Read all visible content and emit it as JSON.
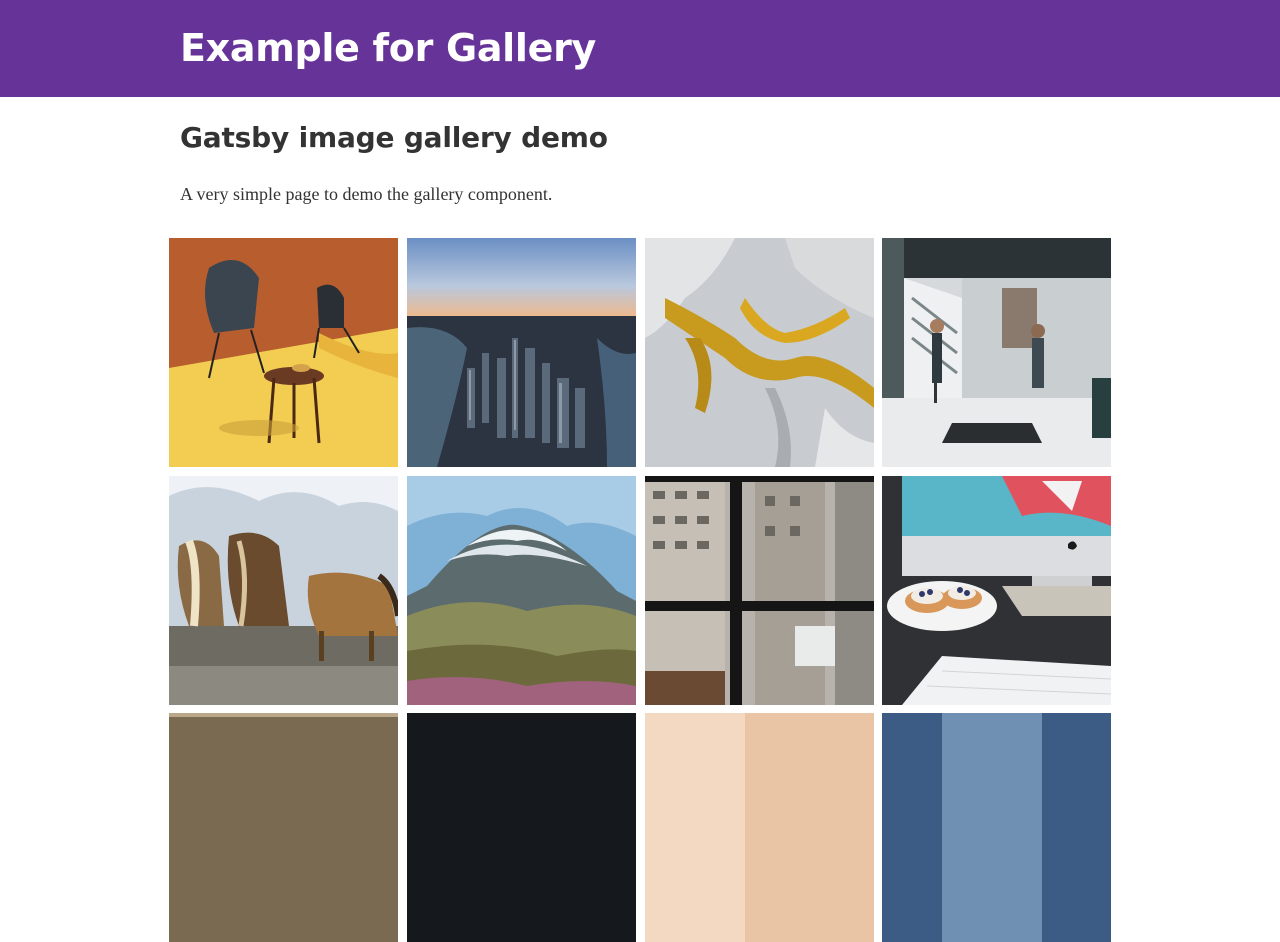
{
  "header": {
    "site_title": "Example for Gallery",
    "background_color": "#663399"
  },
  "main": {
    "heading": "Gatsby image gallery demo",
    "intro": "A very simple page to demo the gallery component."
  },
  "gallery": {
    "images": [
      {
        "subject": "chairs and side table on yellow backdrop"
      },
      {
        "subject": "aerial view of city skyline at sunset"
      },
      {
        "subject": "aerial view of gold and white terrain"
      },
      {
        "subject": "office with ping pong table"
      },
      {
        "subject": "horses grazing"
      },
      {
        "subject": "mountain peak with clouds"
      },
      {
        "subject": "city buildings through window"
      },
      {
        "subject": "desk with computer and pastries"
      },
      {
        "subject": "partially visible image"
      },
      {
        "subject": "partially visible image"
      },
      {
        "subject": "partially visible image"
      },
      {
        "subject": "partially visible image"
      }
    ]
  }
}
